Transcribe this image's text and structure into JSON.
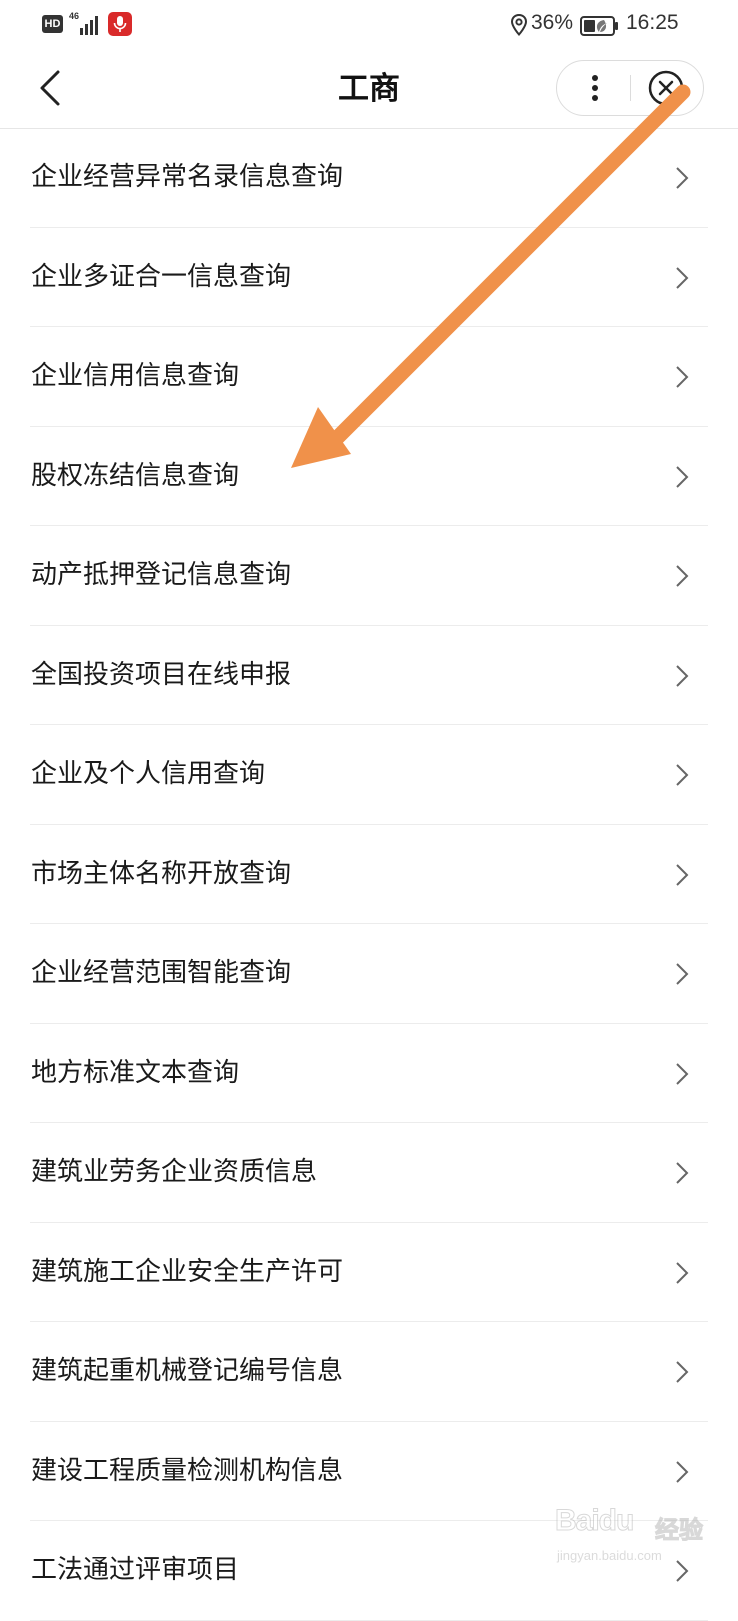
{
  "status_bar": {
    "hd": "HD",
    "network": "46",
    "battery_percent": "36%",
    "time": "16:25"
  },
  "nav": {
    "title": "工商"
  },
  "menu": {
    "items": [
      {
        "label": "企业经营异常名录信息查询"
      },
      {
        "label": "企业多证合一信息查询"
      },
      {
        "label": "企业信用信息查询"
      },
      {
        "label": "股权冻结信息查询"
      },
      {
        "label": "动产抵押登记信息查询"
      },
      {
        "label": "全国投资项目在线申报"
      },
      {
        "label": "企业及个人信用查询"
      },
      {
        "label": "市场主体名称开放查询"
      },
      {
        "label": "企业经营范围智能查询"
      },
      {
        "label": "地方标准文本查询"
      },
      {
        "label": "建筑业劳务企业资质信息"
      },
      {
        "label": "建筑施工企业安全生产许可"
      },
      {
        "label": "建筑起重机械登记编号信息"
      },
      {
        "label": "建设工程质量检测机构信息"
      },
      {
        "label": "工法通过评审项目"
      }
    ]
  },
  "annotation": {
    "arrow_color": "#f0914a"
  },
  "watermark": {
    "brand": "Baidu",
    "jingyan": "经验",
    "url": "jingyan.baidu.com"
  },
  "colors": {
    "text": "#1a1a1a",
    "divider": "#ececec",
    "chevron": "#666666",
    "mic": "#d92a2a"
  }
}
